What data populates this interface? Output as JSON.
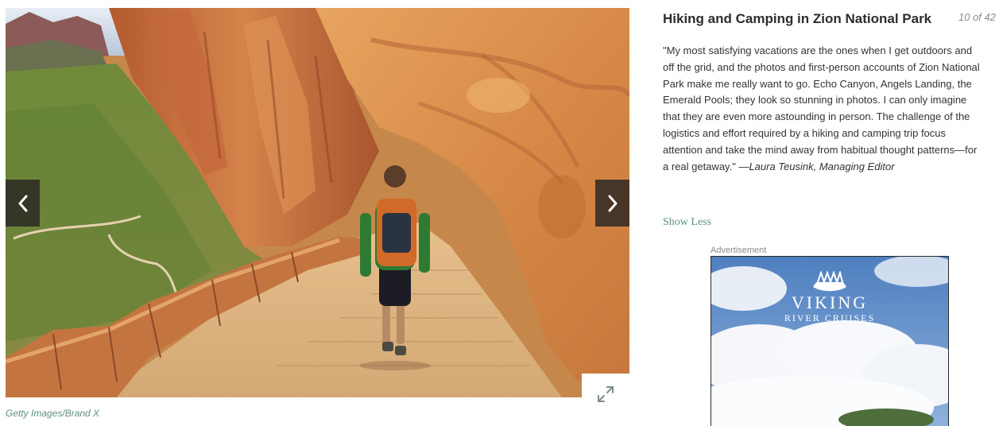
{
  "gallery": {
    "photo_alt": "Hiker walking a sandstone trail in Zion National Park",
    "photo_credit": "Getty Images/Brand X",
    "prev_icon": "chevron-left-icon",
    "next_icon": "chevron-right-icon",
    "expand_icon": "expand-icon"
  },
  "slide": {
    "title": "Hiking and Camping in Zion National Park",
    "counter": "10 of 42",
    "quote": "\"My most satisfying vacations are the ones when I get outdoors and off the grid, and the photos and first-person accounts of Zion National Park make me really want to go. Echo Canyon, Angels Landing, the Emerald Pools; they look so stunning in photos. I can only imagine that they are even more astounding in person. The challenge of the logistics and effort required by a hiking and camping trip focus attention and take the mind away from habitual thought patterns—for a real getaway.\" ",
    "byline": "—Laura Teusink, Managing Editor",
    "toggle_label": "Show Less"
  },
  "advertisement": {
    "label": "Advertisement",
    "brand": "VIKING",
    "tagline": "RIVER CRUISES",
    "logo_icon": "viking-ship-logo-icon"
  },
  "colors": {
    "accent_teal": "#5e9086",
    "nav_button_bg": "#282422",
    "title_text": "#2d2d2d",
    "body_text": "#333333"
  }
}
